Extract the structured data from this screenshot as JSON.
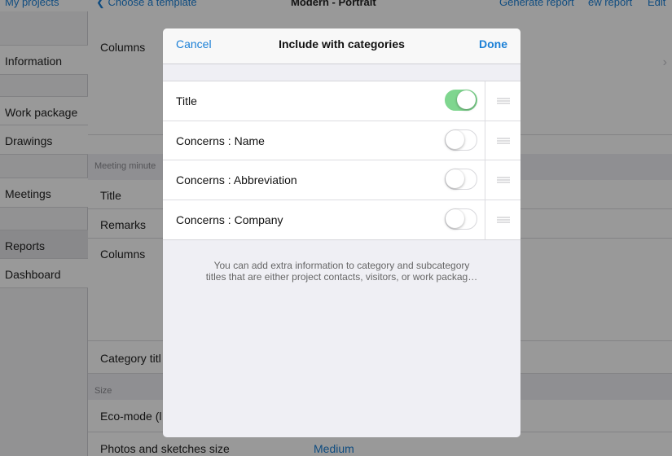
{
  "topbar": {
    "back_projects": "My projects",
    "back_template": "Choose a template",
    "title": "Modern - Portrait",
    "generate": "Generate report",
    "view_report": "ew report",
    "edit": "Edit"
  },
  "sidebar": {
    "items": [
      {
        "label": "Information"
      },
      {
        "label": "Work package"
      },
      {
        "label": "Drawings"
      },
      {
        "label": "Meetings"
      },
      {
        "label": "Reports"
      },
      {
        "label": "Dashboard"
      }
    ]
  },
  "main": {
    "columns_1": "Columns",
    "section_meeting": "Meeting minute",
    "title_row": "Title",
    "remarks_row": "Remarks",
    "columns_2": "Columns",
    "category_title": "Category titl",
    "section_size": "Size",
    "eco_mode": "Eco-mode (l",
    "photos_size": "Photos and sketches size",
    "photos_size_value": "Medium"
  },
  "modal": {
    "cancel": "Cancel",
    "title": "Include with categories",
    "done": "Done",
    "rows": [
      {
        "label": "Title",
        "enabled": true
      },
      {
        "label": "Concerns : Name",
        "enabled": false
      },
      {
        "label": "Concerns : Abbreviation",
        "enabled": false
      },
      {
        "label": "Concerns : Company",
        "enabled": false
      }
    ],
    "note_line1": "You can add extra information to category and subcategory",
    "note_line2": "titles that are either project contacts, visitors, or work packag…"
  },
  "colors": {
    "accent": "#1a7fd6",
    "toggle_on": "#7fd68f"
  }
}
